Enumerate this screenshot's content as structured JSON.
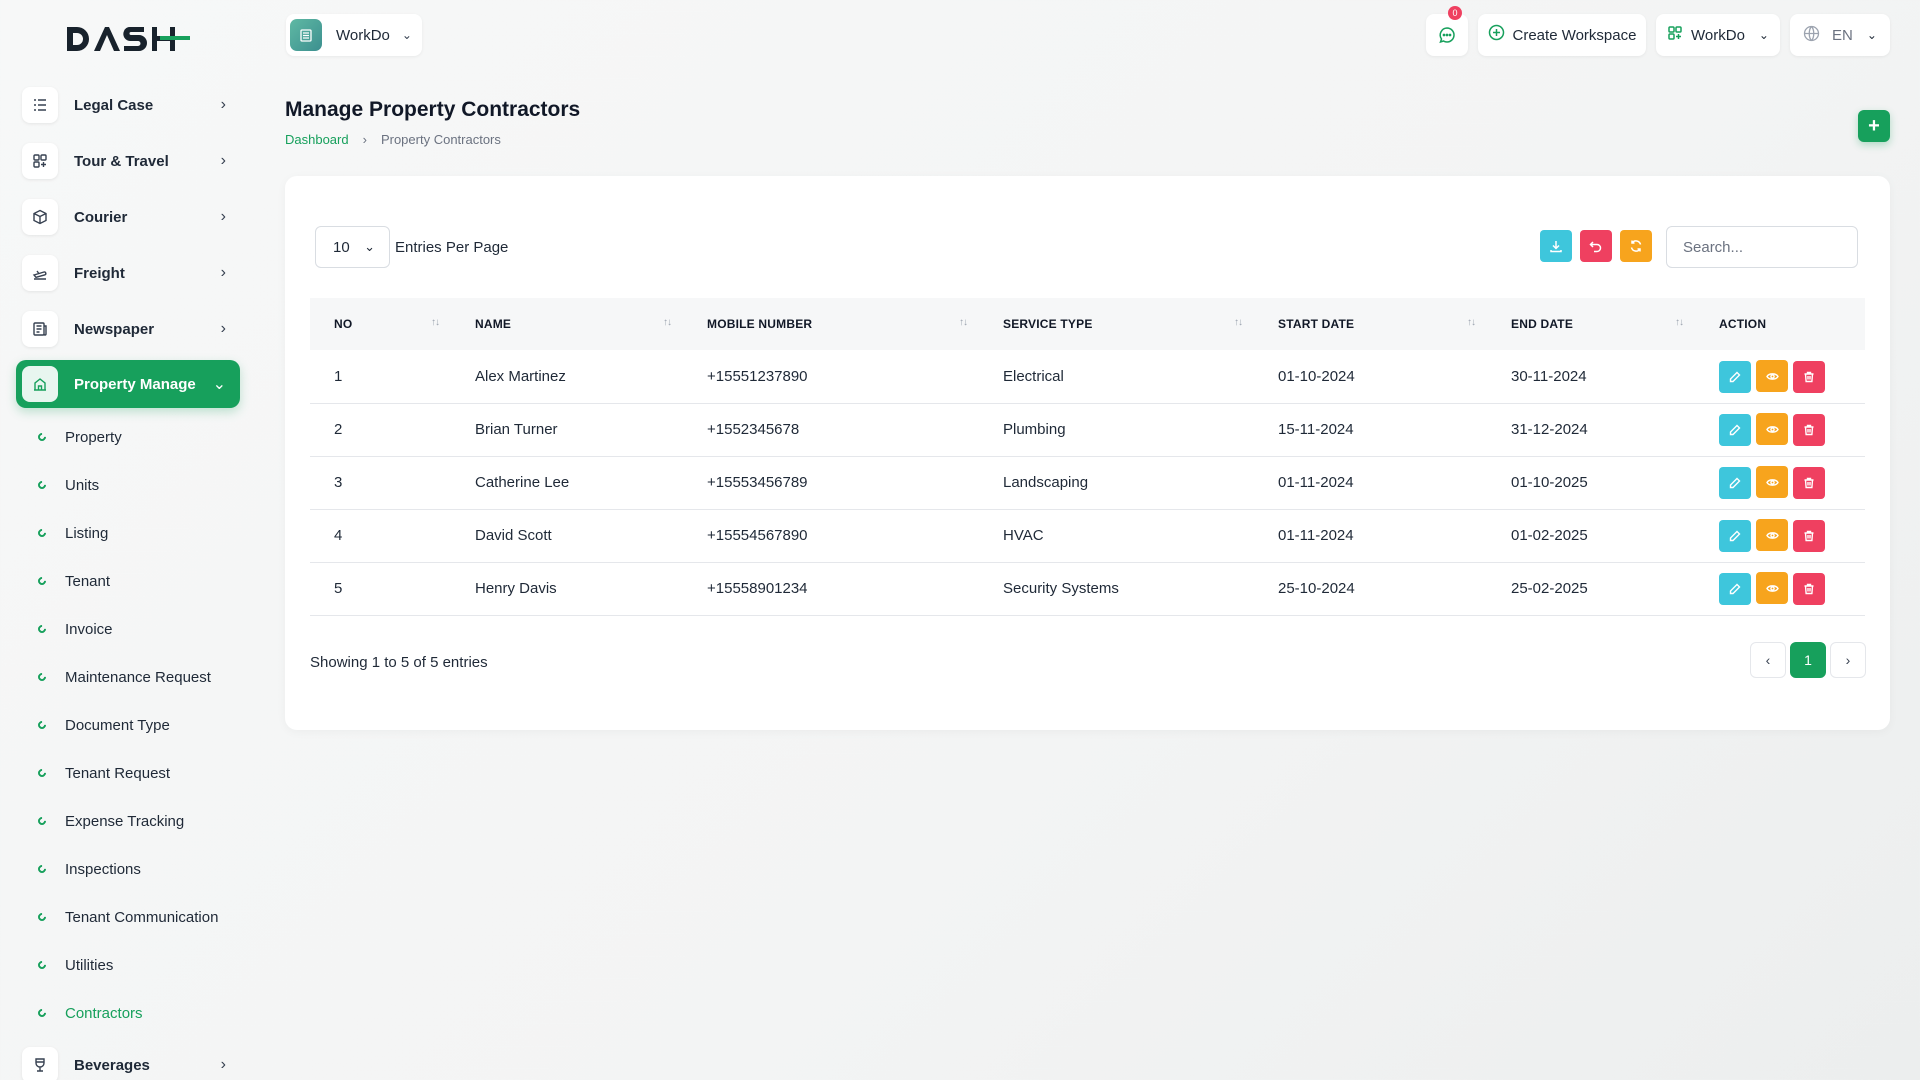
{
  "brand": {
    "logo_text": "DASH"
  },
  "header": {
    "workspace_switch": {
      "name": "WorkDo"
    },
    "messages": {
      "badge_count": "0"
    },
    "create_workspace_label": "Create Workspace",
    "workspace_menu_label": "WorkDo",
    "language_label": "EN"
  },
  "sidebar": {
    "items": [
      {
        "label": "Legal Case",
        "icon": "list-icon"
      },
      {
        "label": "Tour & Travel",
        "icon": "grid-icon"
      },
      {
        "label": "Courier",
        "icon": "box-icon"
      },
      {
        "label": "Freight",
        "icon": "plane-icon"
      },
      {
        "label": "Newspaper",
        "icon": "newspaper-icon"
      },
      {
        "label": "Property Manage",
        "icon": "building-icon"
      },
      {
        "label": "Beverages",
        "icon": "glass-icon"
      }
    ],
    "sub_items": [
      {
        "label": "Property"
      },
      {
        "label": "Units"
      },
      {
        "label": "Listing"
      },
      {
        "label": "Tenant"
      },
      {
        "label": "Invoice"
      },
      {
        "label": "Maintenance Request"
      },
      {
        "label": "Document Type"
      },
      {
        "label": "Tenant Request"
      },
      {
        "label": "Expense Tracking"
      },
      {
        "label": "Inspections"
      },
      {
        "label": "Tenant Communication"
      },
      {
        "label": "Utilities"
      },
      {
        "label": "Contractors"
      }
    ],
    "active_item": "Property Manage",
    "current_sub_item": "Contractors"
  },
  "page": {
    "title": "Manage Property Contractors",
    "breadcrumb": {
      "home": "Dashboard",
      "current": "Property Contractors"
    }
  },
  "table_controls": {
    "per_page_value": "10",
    "per_page_label": "Entries Per Page",
    "search_placeholder": "Search..."
  },
  "table": {
    "columns": [
      "NO",
      "NAME",
      "MOBILE NUMBER",
      "SERVICE TYPE",
      "START DATE",
      "END DATE",
      "ACTION"
    ],
    "rows": [
      {
        "no": "1",
        "name": "Alex Martinez",
        "mobile": "+15551237890",
        "service": "Electrical",
        "start": "01-10-2024",
        "end": "30-11-2024"
      },
      {
        "no": "2",
        "name": "Brian Turner",
        "mobile": "+1552345678",
        "service": "Plumbing",
        "start": "15-11-2024",
        "end": "31-12-2024"
      },
      {
        "no": "3",
        "name": "Catherine Lee",
        "mobile": "+15553456789",
        "service": "Landscaping",
        "start": "01-11-2024",
        "end": "01-10-2025"
      },
      {
        "no": "4",
        "name": "David Scott",
        "mobile": "+15554567890",
        "service": "HVAC",
        "start": "01-11-2024",
        "end": "01-02-2025"
      },
      {
        "no": "5",
        "name": "Henry Davis",
        "mobile": "+15558901234",
        "service": "Security Systems",
        "start": "25-10-2024",
        "end": "25-02-2025"
      }
    ]
  },
  "footer": {
    "showing_text": "Showing 1 to 5 of 5 entries",
    "current_page": "1"
  },
  "colors": {
    "primary": "#17a05c",
    "info": "#3ec6dc",
    "warning": "#f7a41d",
    "danger": "#ef4060"
  }
}
